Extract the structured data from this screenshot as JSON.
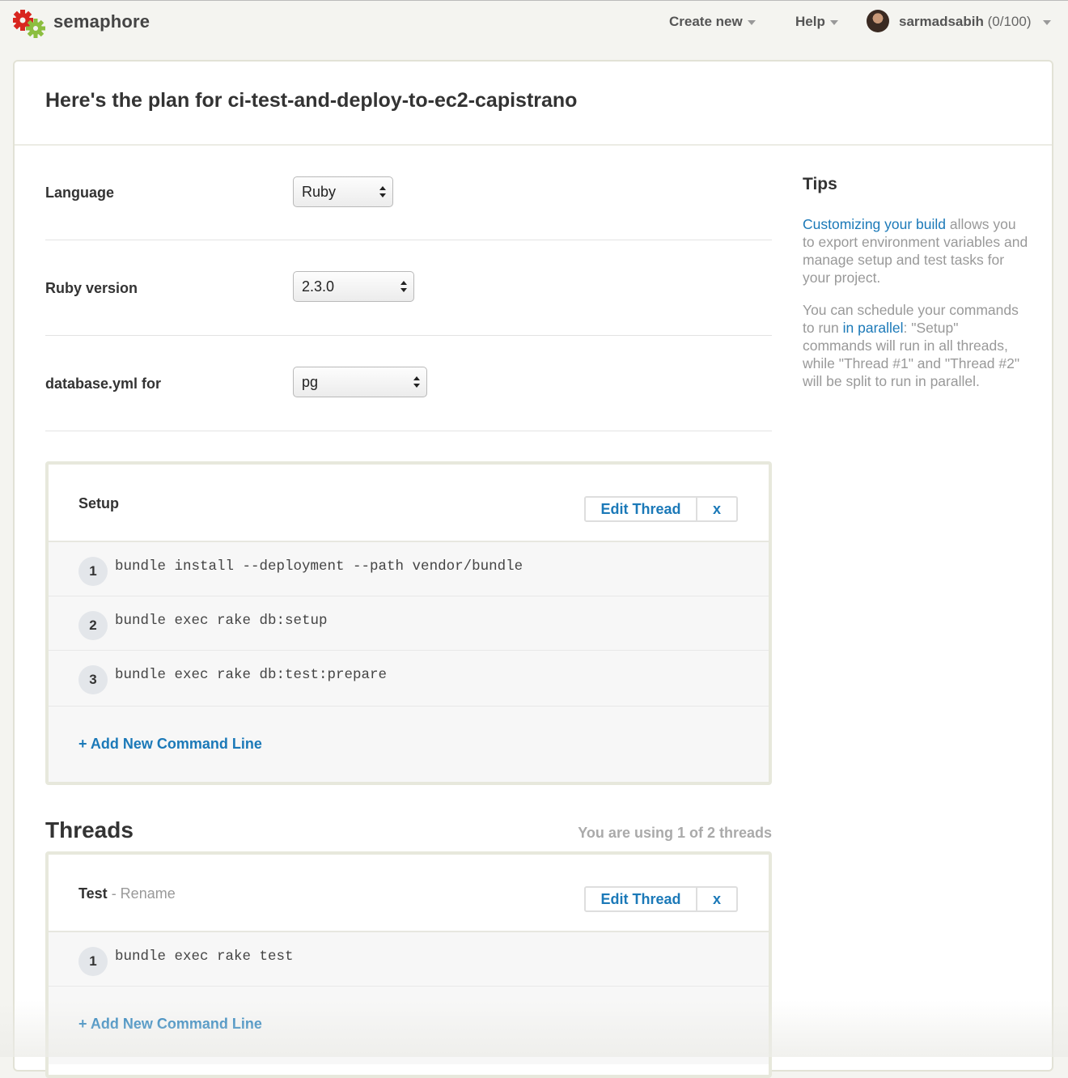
{
  "header": {
    "brand": "semaphore",
    "logo_icon": "semaphore-gear-logo",
    "nav": [
      {
        "label": "Create new"
      },
      {
        "label": "Help"
      }
    ],
    "user": {
      "name": "sarmadsabih",
      "count": "(0/100)"
    }
  },
  "page": {
    "title": "Here's the plan for ci-test-and-deploy-to-ec2-capistrano"
  },
  "settings": {
    "language": {
      "label": "Language",
      "value": "Ruby"
    },
    "ruby_version": {
      "label": "Ruby version",
      "value": "2.3.0"
    },
    "database": {
      "label": "database.yml for",
      "value": "pg"
    }
  },
  "tips": {
    "title": "Tips",
    "tip1": {
      "link": "Customizing your build",
      "text": " allows you to export environment variables and manage setup and test tasks for your project."
    },
    "tip2": {
      "prefix": "You can schedule your commands to run ",
      "link": "in parallel",
      "text": ": \"Setup\" commands will run in all threads, while \"Thread #1\" and \"Thread #2\" will be split to run in parallel."
    }
  },
  "setup": {
    "name": "Setup",
    "edit_label": "Edit Thread",
    "remove_label": "x",
    "commands": [
      {
        "num": "1",
        "text": "bundle install --deployment --path vendor/bundle"
      },
      {
        "num": "2",
        "text": "bundle exec rake db:setup"
      },
      {
        "num": "3",
        "text": "bundle exec rake db:test:prepare"
      }
    ],
    "add_label": "+ Add New Command Line"
  },
  "threads": {
    "heading": "Threads",
    "usage": "You are using 1 of 2 threads",
    "items": [
      {
        "name": "Test",
        "rename_label": " - Rename",
        "edit_label": "Edit Thread",
        "remove_label": "x",
        "commands": [
          {
            "num": "1",
            "text": "bundle exec rake test"
          }
        ],
        "add_label": "+ Add New Command Line"
      }
    ]
  },
  "colors": {
    "link": "#1b79b8",
    "logo_red": "#d8261f",
    "logo_green": "#8cbe3f"
  }
}
